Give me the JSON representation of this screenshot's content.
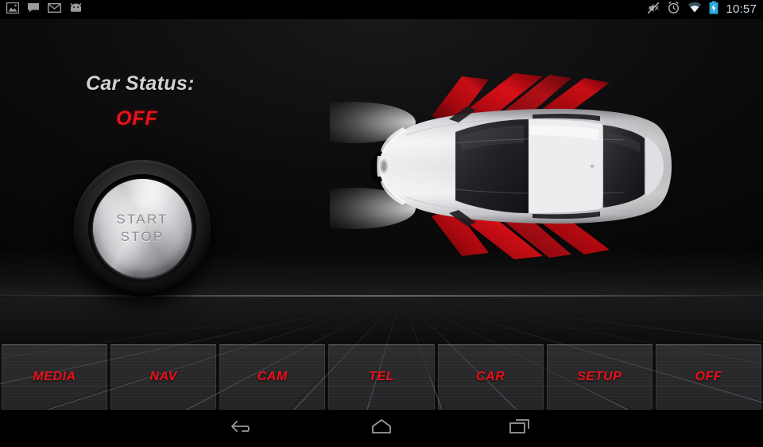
{
  "status_bar": {
    "left_icons": [
      {
        "name": "photo-icon"
      },
      {
        "name": "message-icon"
      },
      {
        "name": "email-icon"
      },
      {
        "name": "android-icon"
      }
    ],
    "right_icons": [
      {
        "name": "mute-icon"
      },
      {
        "name": "alarm-clock-icon"
      },
      {
        "name": "wifi-icon"
      },
      {
        "name": "battery-charging-icon"
      }
    ],
    "clock": "10:57"
  },
  "main": {
    "car_status_label": "Car Status:",
    "car_status_value": "OFF",
    "start_stop_button": {
      "line1": "START",
      "line2": "STOP"
    },
    "car_graphic_name": "car-top-view-doors-open"
  },
  "menu": {
    "buttons": [
      {
        "label": "MEDIA",
        "name": "menu-button-media"
      },
      {
        "label": "NAV",
        "name": "menu-button-nav"
      },
      {
        "label": "CAM",
        "name": "menu-button-cam"
      },
      {
        "label": "TEL",
        "name": "menu-button-tel"
      },
      {
        "label": "CAR",
        "name": "menu-button-car"
      },
      {
        "label": "SETUP",
        "name": "menu-button-setup"
      },
      {
        "label": "OFF",
        "name": "menu-button-off"
      }
    ]
  },
  "nav_bar": {
    "buttons": [
      {
        "name": "back-icon"
      },
      {
        "name": "home-icon"
      },
      {
        "name": "recents-icon"
      }
    ]
  },
  "colors": {
    "accent_red": "#ee1118",
    "status_value_red": "#e8121a",
    "label_gray": "#d2d2d4",
    "background": "#000000",
    "clock_blue": "#c8d9e4"
  }
}
